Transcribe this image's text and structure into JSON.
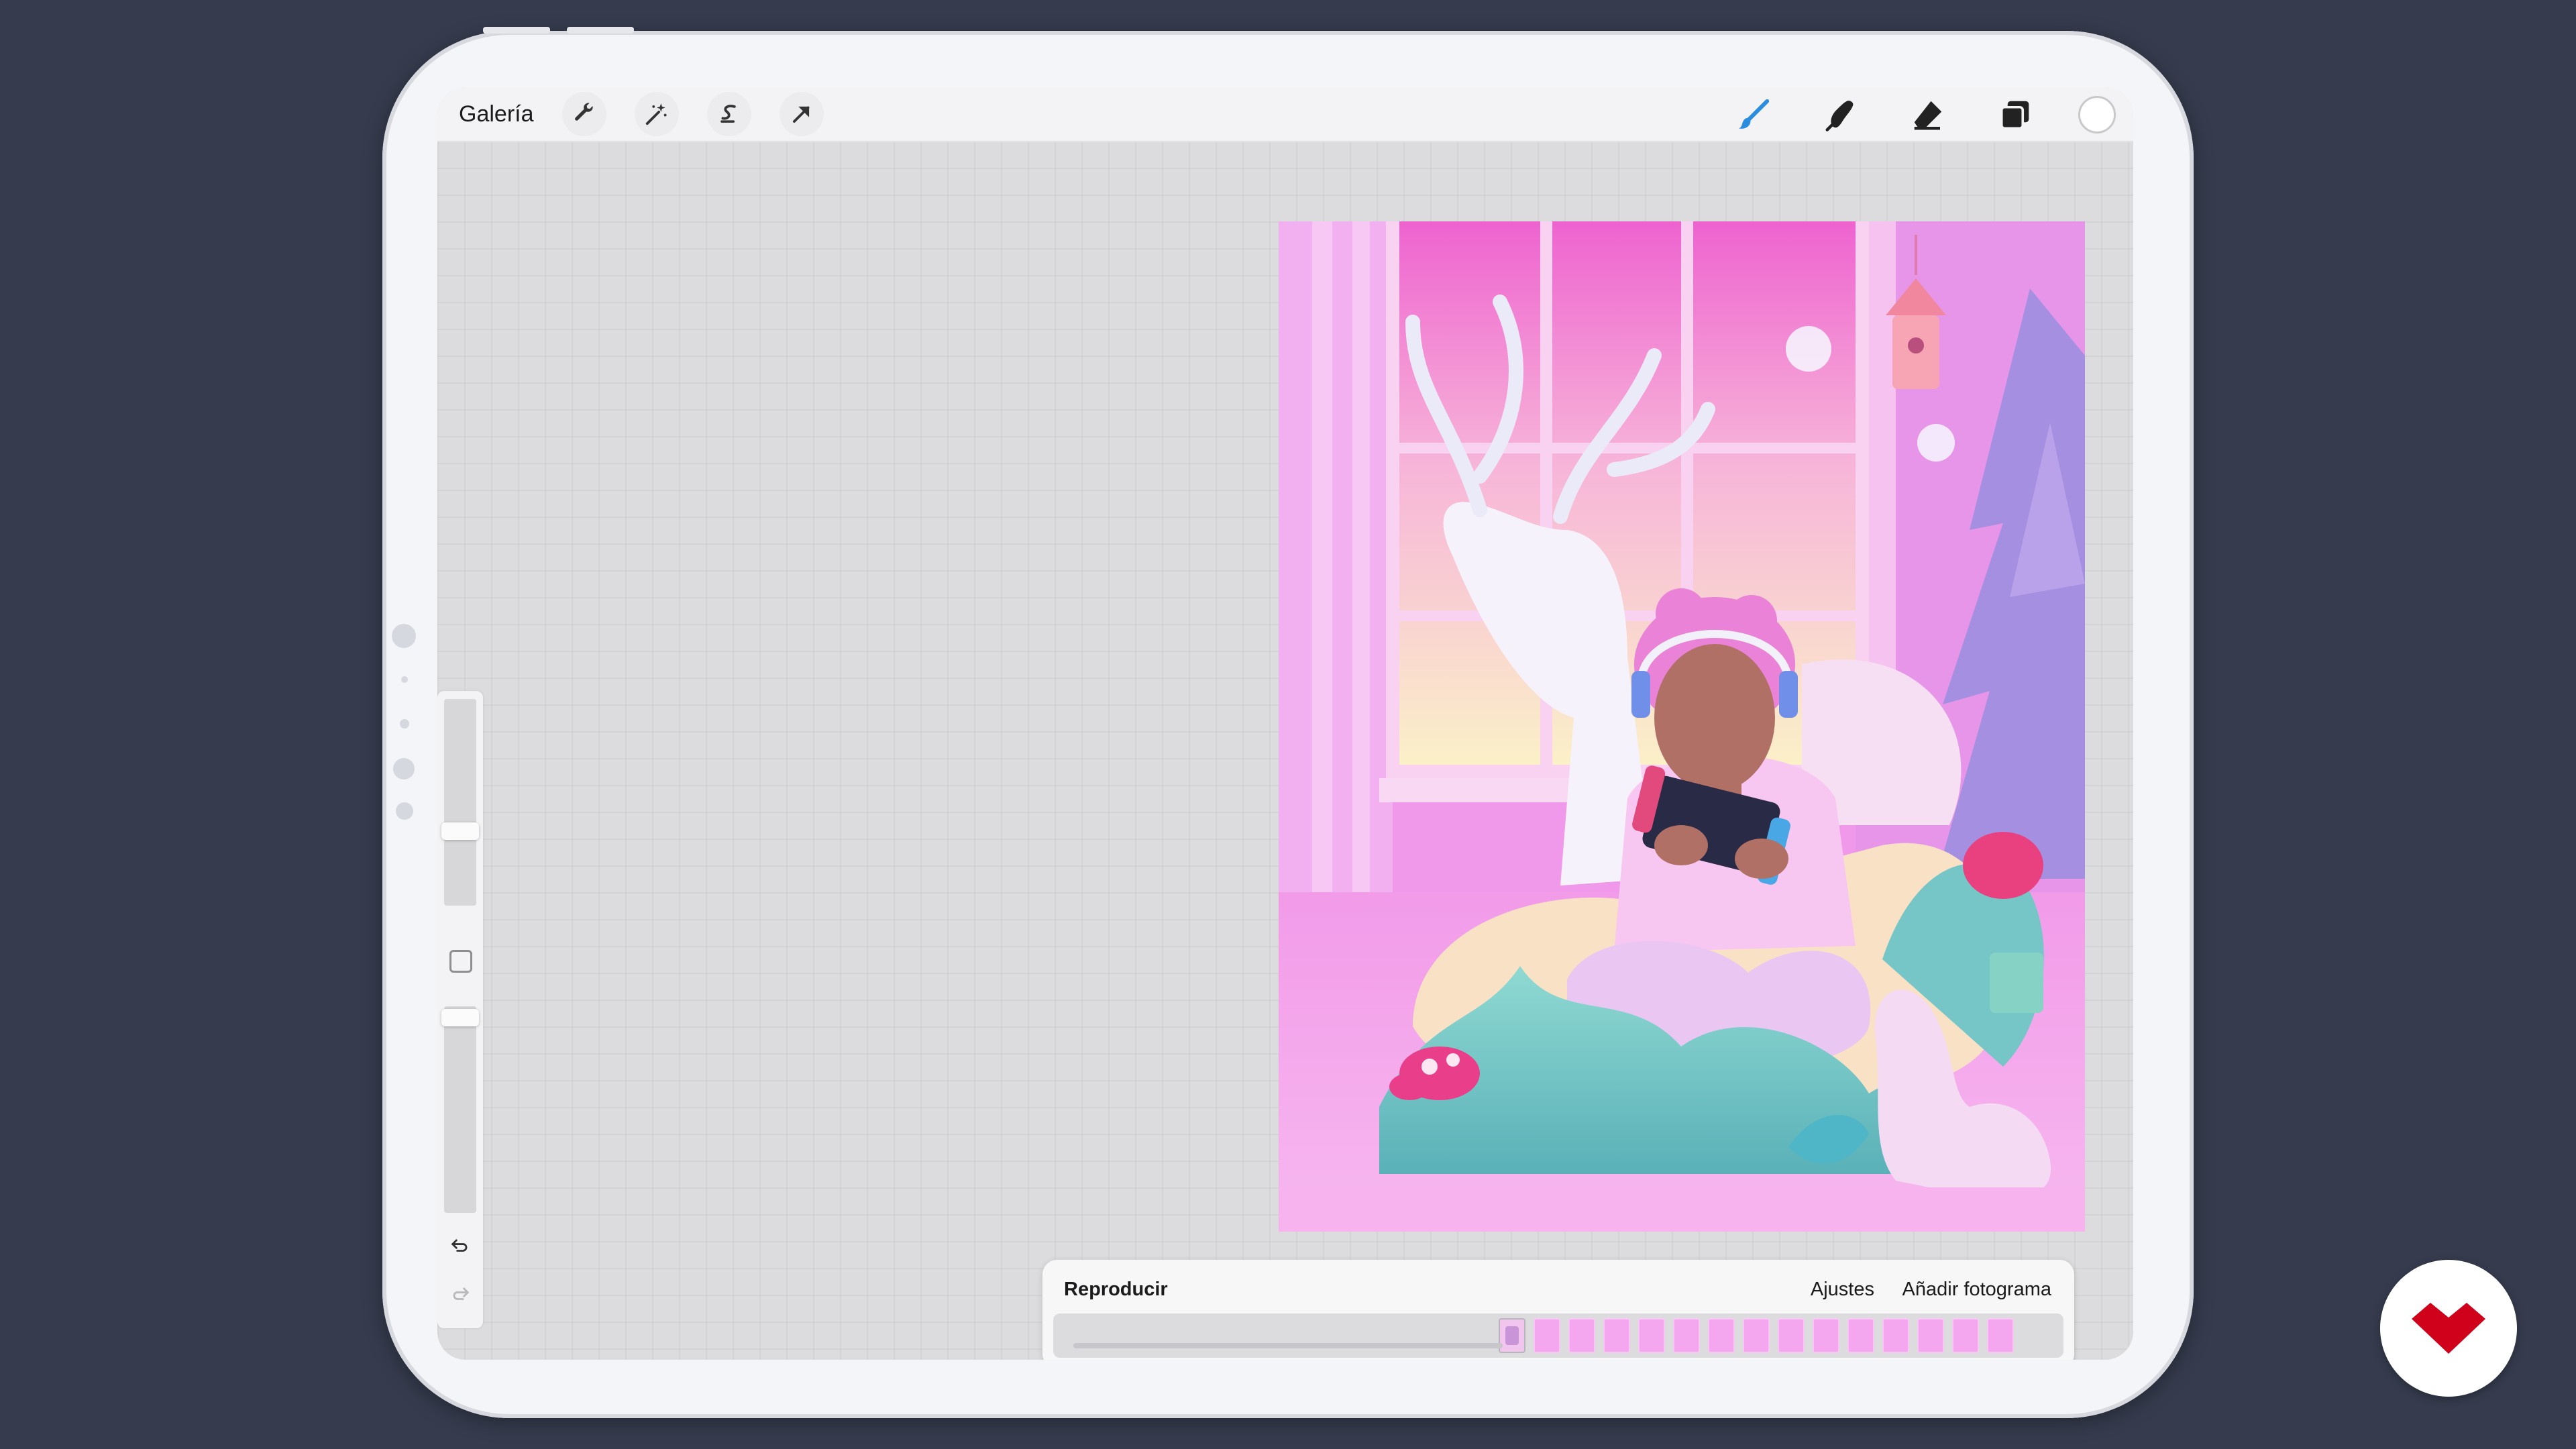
{
  "toolbar": {
    "gallery_label": "Galería",
    "left_tools": [
      "wrench-icon",
      "magic-wand-icon",
      "selection-icon",
      "transform-arrow-icon"
    ],
    "right_tools": [
      "brush-icon",
      "smudge-icon",
      "eraser-icon",
      "layers-icon"
    ],
    "active_tool": "brush-icon",
    "current_color": "#ffffff"
  },
  "animation": {
    "play_label": "Reproducir",
    "settings_label": "Ajustes",
    "add_frame_label": "Añadir fotograma",
    "frame_count": 15
  },
  "colors": {
    "background": "#363c4e",
    "accent": "#2b8de0",
    "brand": "#d0021b"
  }
}
